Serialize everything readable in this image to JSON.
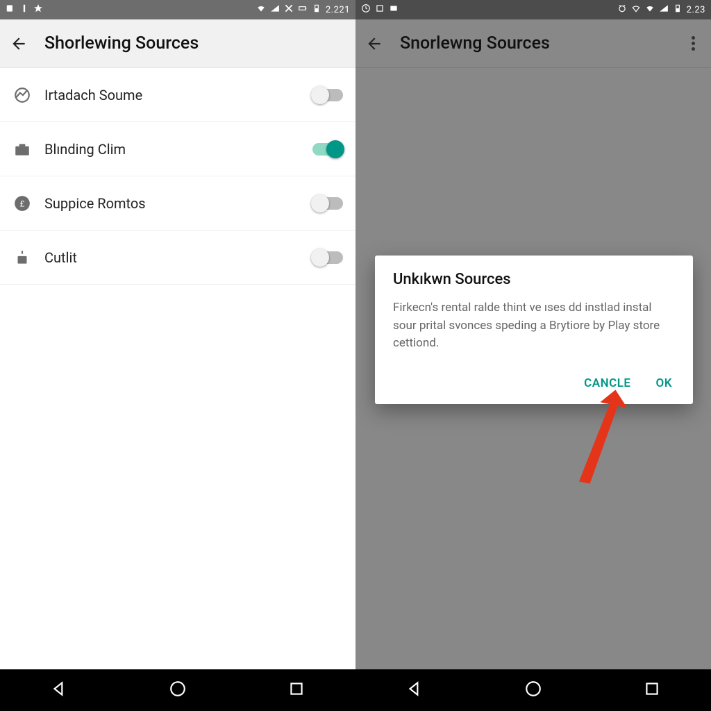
{
  "left": {
    "status": {
      "time": "2.221"
    },
    "appbar": {
      "title": "Shorlewing Sources"
    },
    "rows": [
      {
        "label": "Irtadach Soume",
        "on": false,
        "icon": "circle"
      },
      {
        "label": "Blınding Clim",
        "on": true,
        "icon": "briefcase"
      },
      {
        "label": "Suppice Romtos",
        "on": false,
        "icon": "badge"
      },
      {
        "label": "Cutlit",
        "on": false,
        "icon": "lock"
      }
    ]
  },
  "right": {
    "status": {
      "time": "2.23"
    },
    "appbar": {
      "title": "Snorlewng Sources"
    },
    "dialog": {
      "title": "Unkıkwn Sources",
      "body": "Firkecn's rental ralde thint ve ıses dd instlad instal sour prital svonces speding a Brytiore by Play store cettiond.",
      "cancel": "CANCLE",
      "ok": "OK"
    }
  }
}
